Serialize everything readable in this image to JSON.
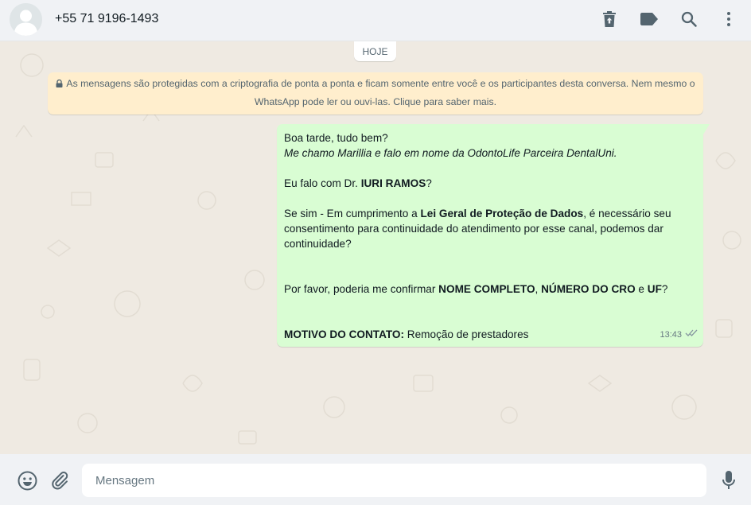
{
  "header": {
    "contact_name": "+55 71 9196-1493",
    "icons": [
      "delete-icon",
      "label-icon",
      "search-icon",
      "menu-icon"
    ]
  },
  "chat": {
    "day_label": "HOJE",
    "encryption_notice": "As mensagens são protegidas com a criptografia de ponta a ponta e ficam somente entre você e os participantes desta conversa. Nem mesmo o WhatsApp pode ler ou ouvi-las. Clique para saber mais.",
    "message": {
      "greeting": "Boa tarde, tudo bem?",
      "intro": "Me chamo Marillia e falo em nome da OdontoLife Parceira DentalUni.",
      "q_prefix": "Eu falo com Dr. ",
      "q_name": "IURI RAMOS",
      "q_suffix": "?",
      "lgpd_prefix": "Se sim - Em cumprimento a ",
      "lgpd_bold": "Lei Geral de Proteção de Dados",
      "lgpd_suffix": ", é necessário seu consentimento para continuidade do atendimento por esse canal, podemos dar continuidade?",
      "confirm_prefix": "Por favor, poderia me confirmar ",
      "confirm_b1": "NOME COMPLETO",
      "confirm_sep1": ", ",
      "confirm_b2": "NÚMERO DO CRO",
      "confirm_sep2": " e ",
      "confirm_b3": "UF",
      "confirm_suffix": "?",
      "motivo_label": "MOTIVO DO CONTATO:",
      "motivo_value": " Remoção de prestadores",
      "time": "13:43",
      "status": "read"
    }
  },
  "footer": {
    "placeholder": "Mensagem",
    "icons": [
      "emoji-icon",
      "attach-icon",
      "mic-icon"
    ]
  },
  "colors": {
    "bubble_out": "#d9fdd3",
    "notice_bg": "#ffeecd",
    "chat_bg": "#efeae2",
    "bar_bg": "#f0f2f5"
  }
}
